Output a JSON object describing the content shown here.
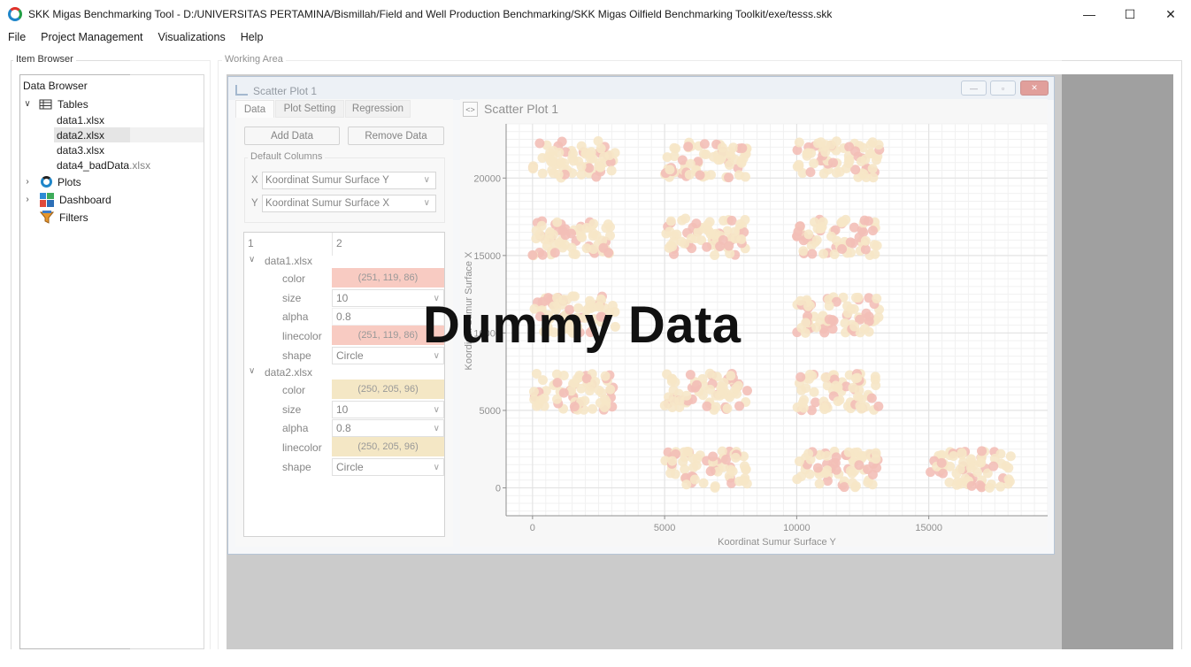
{
  "window": {
    "title": "SKK Migas Benchmarking Tool - D:/UNIVERSITAS PERTAMINA/Bismillah/Field and Well Production Benchmarking/SKK Migas Oilfield Benchmarking Toolkit/exe/tesss.skk",
    "minimize_icon": "minimize-icon",
    "maximize_icon": "maximize-icon",
    "close_icon": "close-icon"
  },
  "menu": [
    "File",
    "Project Management",
    "Visualizations",
    "Help"
  ],
  "item_browser": {
    "label": "Item Browser",
    "header": "Data Browser",
    "tables_label": "Tables",
    "tables": [
      "data1.xlsx",
      "data2.xlsx",
      "data3.xlsx",
      "data4_badData.xlsx"
    ],
    "selected_table": "data2.xlsx",
    "plots_label": "Plots",
    "dashboard_label": "Dashboard",
    "filters_label": "Filters"
  },
  "working_area": {
    "label": "Working Area",
    "subwindow_title": "Scatter Plot 1",
    "tabs": [
      "Data",
      "Plot Setting",
      "Regression"
    ],
    "active_tab": "Data",
    "add_data": "Add Data",
    "remove_data": "Remove Data",
    "default_columns_label": "Default Columns",
    "x_label": "X",
    "y_label": "Y",
    "x_value": "Koordinat Sumur Surface Y",
    "y_value": "Koordinat Sumur Surface X",
    "prop_header_1": "1",
    "prop_header_2": "2",
    "datasets": [
      {
        "name": "data1.xlsx",
        "color_label": "color",
        "color_value": "(251, 119, 86)",
        "color_hex": "#f2a090",
        "size_label": "size",
        "size_value": "10",
        "alpha_label": "alpha",
        "alpha_value": "0.8",
        "linecolor_label": "linecolor",
        "linecolor_value": "(251, 119, 86)",
        "shape_label": "shape",
        "shape_value": "Circle"
      },
      {
        "name": "data2.xlsx",
        "color_label": "color",
        "color_value": "(250, 205, 96)",
        "color_hex": "#ecd495",
        "size_label": "size",
        "size_value": "10",
        "alpha_label": "alpha",
        "alpha_value": "0.8",
        "linecolor_label": "linecolor",
        "linecolor_value": "(250, 205, 96)",
        "shape_label": "shape",
        "shape_value": "Circle"
      }
    ],
    "plot_header_btn": "<>",
    "plot_title": "Scatter Plot 1",
    "overlay_text": "Dummy Data"
  },
  "chart_data": {
    "type": "scatter",
    "xlabel": "Koordinat Sumur Surface Y",
    "ylabel": "Koordinat Sumur Surface X",
    "xlim": [
      -1000,
      19500
    ],
    "ylim": [
      -1800,
      23500
    ],
    "x_ticks": [
      0,
      5000,
      10000,
      15000
    ],
    "y_ticks": [
      0,
      5000,
      10000,
      15000,
      20000
    ],
    "grid": true,
    "series": [
      {
        "name": "data1.xlsx",
        "color": "#e98a7c"
      },
      {
        "name": "data2.xlsx",
        "color": "#f0d39a"
      }
    ],
    "clusters": [
      {
        "x": [
          0,
          3300
        ],
        "y": [
          20000,
          22400
        ]
      },
      {
        "x": [
          5000,
          8300
        ],
        "y": [
          20000,
          22400
        ]
      },
      {
        "x": [
          10000,
          13300
        ],
        "y": [
          20000,
          22400
        ]
      },
      {
        "x": [
          0,
          3300
        ],
        "y": [
          15000,
          17400
        ]
      },
      {
        "x": [
          5000,
          8300
        ],
        "y": [
          15000,
          17400
        ]
      },
      {
        "x": [
          10000,
          13300
        ],
        "y": [
          15000,
          17400
        ]
      },
      {
        "x": [
          0,
          3300
        ],
        "y": [
          10000,
          12400
        ]
      },
      {
        "x": [
          10000,
          13300
        ],
        "y": [
          10000,
          12400
        ]
      },
      {
        "x": [
          0,
          3300
        ],
        "y": [
          5000,
          7400
        ]
      },
      {
        "x": [
          5000,
          8300
        ],
        "y": [
          5000,
          7400
        ]
      },
      {
        "x": [
          10000,
          13300
        ],
        "y": [
          5000,
          7400
        ]
      },
      {
        "x": [
          5000,
          8300
        ],
        "y": [
          0,
          2400
        ]
      },
      {
        "x": [
          10000,
          13300
        ],
        "y": [
          0,
          2400
        ]
      },
      {
        "x": [
          15000,
          18300
        ],
        "y": [
          0,
          2400
        ]
      }
    ]
  }
}
